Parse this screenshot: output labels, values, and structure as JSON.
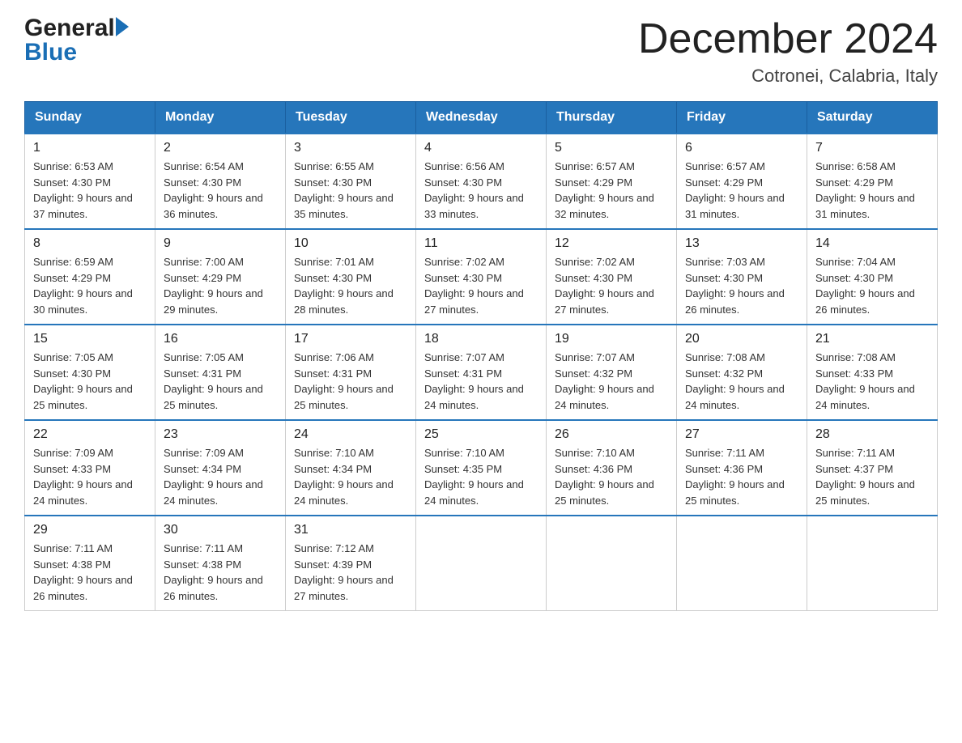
{
  "header": {
    "title": "December 2024",
    "subtitle": "Cotronei, Calabria, Italy"
  },
  "logo": {
    "line1": "General",
    "line2": "Blue"
  },
  "days_header": [
    "Sunday",
    "Monday",
    "Tuesday",
    "Wednesday",
    "Thursday",
    "Friday",
    "Saturday"
  ],
  "weeks": [
    [
      {
        "day": "1",
        "sunrise": "6:53 AM",
        "sunset": "4:30 PM",
        "daylight": "9 hours and 37 minutes."
      },
      {
        "day": "2",
        "sunrise": "6:54 AM",
        "sunset": "4:30 PM",
        "daylight": "9 hours and 36 minutes."
      },
      {
        "day": "3",
        "sunrise": "6:55 AM",
        "sunset": "4:30 PM",
        "daylight": "9 hours and 35 minutes."
      },
      {
        "day": "4",
        "sunrise": "6:56 AM",
        "sunset": "4:30 PM",
        "daylight": "9 hours and 33 minutes."
      },
      {
        "day": "5",
        "sunrise": "6:57 AM",
        "sunset": "4:29 PM",
        "daylight": "9 hours and 32 minutes."
      },
      {
        "day": "6",
        "sunrise": "6:57 AM",
        "sunset": "4:29 PM",
        "daylight": "9 hours and 31 minutes."
      },
      {
        "day": "7",
        "sunrise": "6:58 AM",
        "sunset": "4:29 PM",
        "daylight": "9 hours and 31 minutes."
      }
    ],
    [
      {
        "day": "8",
        "sunrise": "6:59 AM",
        "sunset": "4:29 PM",
        "daylight": "9 hours and 30 minutes."
      },
      {
        "day": "9",
        "sunrise": "7:00 AM",
        "sunset": "4:29 PM",
        "daylight": "9 hours and 29 minutes."
      },
      {
        "day": "10",
        "sunrise": "7:01 AM",
        "sunset": "4:30 PM",
        "daylight": "9 hours and 28 minutes."
      },
      {
        "day": "11",
        "sunrise": "7:02 AM",
        "sunset": "4:30 PM",
        "daylight": "9 hours and 27 minutes."
      },
      {
        "day": "12",
        "sunrise": "7:02 AM",
        "sunset": "4:30 PM",
        "daylight": "9 hours and 27 minutes."
      },
      {
        "day": "13",
        "sunrise": "7:03 AM",
        "sunset": "4:30 PM",
        "daylight": "9 hours and 26 minutes."
      },
      {
        "day": "14",
        "sunrise": "7:04 AM",
        "sunset": "4:30 PM",
        "daylight": "9 hours and 26 minutes."
      }
    ],
    [
      {
        "day": "15",
        "sunrise": "7:05 AM",
        "sunset": "4:30 PM",
        "daylight": "9 hours and 25 minutes."
      },
      {
        "day": "16",
        "sunrise": "7:05 AM",
        "sunset": "4:31 PM",
        "daylight": "9 hours and 25 minutes."
      },
      {
        "day": "17",
        "sunrise": "7:06 AM",
        "sunset": "4:31 PM",
        "daylight": "9 hours and 25 minutes."
      },
      {
        "day": "18",
        "sunrise": "7:07 AM",
        "sunset": "4:31 PM",
        "daylight": "9 hours and 24 minutes."
      },
      {
        "day": "19",
        "sunrise": "7:07 AM",
        "sunset": "4:32 PM",
        "daylight": "9 hours and 24 minutes."
      },
      {
        "day": "20",
        "sunrise": "7:08 AM",
        "sunset": "4:32 PM",
        "daylight": "9 hours and 24 minutes."
      },
      {
        "day": "21",
        "sunrise": "7:08 AM",
        "sunset": "4:33 PM",
        "daylight": "9 hours and 24 minutes."
      }
    ],
    [
      {
        "day": "22",
        "sunrise": "7:09 AM",
        "sunset": "4:33 PM",
        "daylight": "9 hours and 24 minutes."
      },
      {
        "day": "23",
        "sunrise": "7:09 AM",
        "sunset": "4:34 PM",
        "daylight": "9 hours and 24 minutes."
      },
      {
        "day": "24",
        "sunrise": "7:10 AM",
        "sunset": "4:34 PM",
        "daylight": "9 hours and 24 minutes."
      },
      {
        "day": "25",
        "sunrise": "7:10 AM",
        "sunset": "4:35 PM",
        "daylight": "9 hours and 24 minutes."
      },
      {
        "day": "26",
        "sunrise": "7:10 AM",
        "sunset": "4:36 PM",
        "daylight": "9 hours and 25 minutes."
      },
      {
        "day": "27",
        "sunrise": "7:11 AM",
        "sunset": "4:36 PM",
        "daylight": "9 hours and 25 minutes."
      },
      {
        "day": "28",
        "sunrise": "7:11 AM",
        "sunset": "4:37 PM",
        "daylight": "9 hours and 25 minutes."
      }
    ],
    [
      {
        "day": "29",
        "sunrise": "7:11 AM",
        "sunset": "4:38 PM",
        "daylight": "9 hours and 26 minutes."
      },
      {
        "day": "30",
        "sunrise": "7:11 AM",
        "sunset": "4:38 PM",
        "daylight": "9 hours and 26 minutes."
      },
      {
        "day": "31",
        "sunrise": "7:12 AM",
        "sunset": "4:39 PM",
        "daylight": "9 hours and 27 minutes."
      },
      null,
      null,
      null,
      null
    ]
  ]
}
